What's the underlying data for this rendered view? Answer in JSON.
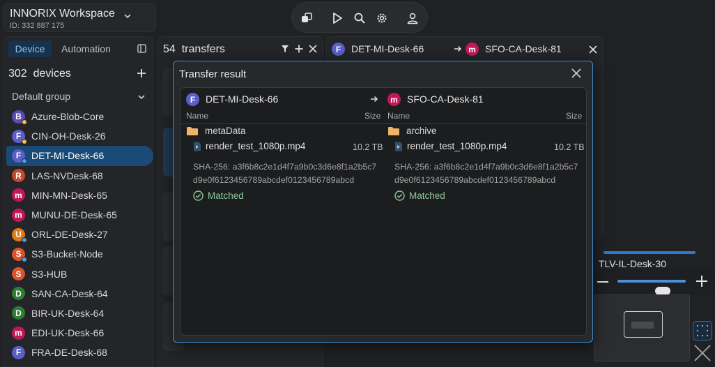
{
  "workspace": {
    "title": "INNORIX Workspace",
    "id_label": "ID: 332 887 175"
  },
  "toolbar": {
    "icons": [
      "copy-icon",
      "play-icon",
      "search-icon",
      "gear-icon",
      "user-icon"
    ]
  },
  "left_panel": {
    "tabs": [
      {
        "label": "Device",
        "active": true
      },
      {
        "label": "Automation",
        "active": false
      }
    ],
    "device_count": "302",
    "device_count_unit": "devices",
    "group": "Default group",
    "devices": [
      {
        "initial": "B",
        "name": "Azure-Blob-Core",
        "color": "#5b4bb7",
        "status": "#f5c142"
      },
      {
        "initial": "F",
        "name": "CIN-OH-Desk-26",
        "color": "#5b5fc7",
        "status": "#f5c142"
      },
      {
        "initial": "F",
        "name": "DET-MI-Desk-66",
        "color": "#5b5fc7",
        "status": "#4b9ff0",
        "selected": true
      },
      {
        "initial": "R",
        "name": "LAS-NVDesk-68",
        "color": "#c24a2a",
        "status": ""
      },
      {
        "initial": "m",
        "name": "MIN-MN-Desk-65",
        "color": "#c2185b",
        "status": ""
      },
      {
        "initial": "m",
        "name": "MUNU-DE-Desk-65",
        "color": "#c2185b",
        "status": ""
      },
      {
        "initial": "U",
        "name": "ORL-DE-Desk-27",
        "color": "#e07b18",
        "status": "#4b9ff0"
      },
      {
        "initial": "S",
        "name": "S3-Bucket-Node",
        "color": "#d9542b",
        "status": "#4b9ff0"
      },
      {
        "initial": "S",
        "name": "S3-HUB",
        "color": "#d9542b",
        "status": ""
      },
      {
        "initial": "D",
        "name": "SAN-CA-Desk-64",
        "color": "#2e7d32",
        "status": ""
      },
      {
        "initial": "D",
        "name": "BIR-UK-Desk-64",
        "color": "#2e7d32",
        "status": ""
      },
      {
        "initial": "m",
        "name": "EDI-UK-Desk-66",
        "color": "#c2185b",
        "status": ""
      },
      {
        "initial": "F",
        "name": "FRA-DE-Desk-68",
        "color": "#5b5fc7",
        "status": ""
      }
    ]
  },
  "transfers": {
    "count": "54",
    "label": "transfers"
  },
  "compare": {
    "source": {
      "initial": "F",
      "name": "DET-MI-Desk-66",
      "color": "#5b5fc7"
    },
    "target": {
      "initial": "m",
      "name": "SFO-CA-Desk-81",
      "color": "#c2185b"
    }
  },
  "modal": {
    "title": "Transfer result",
    "source": {
      "initial": "F",
      "name": "DET-MI-Desk-66",
      "color": "#5b5fc7",
      "col_name": "Name",
      "col_size": "Size",
      "folder": "metaData",
      "file": "render_test_1080p.mp4",
      "size": "10.2 TB",
      "sha_line1": "SHA-256: a3f6b8c2e1d4f7a9b0c3d6e8f1a2b5c7",
      "sha_line2": "d9e0f6123456789abcdef0123456789abcd",
      "status": "Matched"
    },
    "target": {
      "initial": "m",
      "name": "SFO-CA-Desk-81",
      "color": "#c2185b",
      "col_name": "Name",
      "col_size": "Size",
      "folder": "archive",
      "file": "render_test_1080p.mp4",
      "size": "10.2 TB",
      "sha_line1": "SHA-256: a3f6b8c2e1d4f7a9b0c3d6e8f1a2b5c7",
      "sha_line2": "d9e0f6123456789abcdef0123456789abcd",
      "status": "Matched"
    }
  },
  "minimap": {
    "device": "TLV-IL-Desk-30",
    "zoom_level": 0.62
  },
  "colors": {
    "accent": "#3b8fd3",
    "success": "#8dc79a",
    "folder": "#f0b36a",
    "selected": "#1a4a76"
  }
}
